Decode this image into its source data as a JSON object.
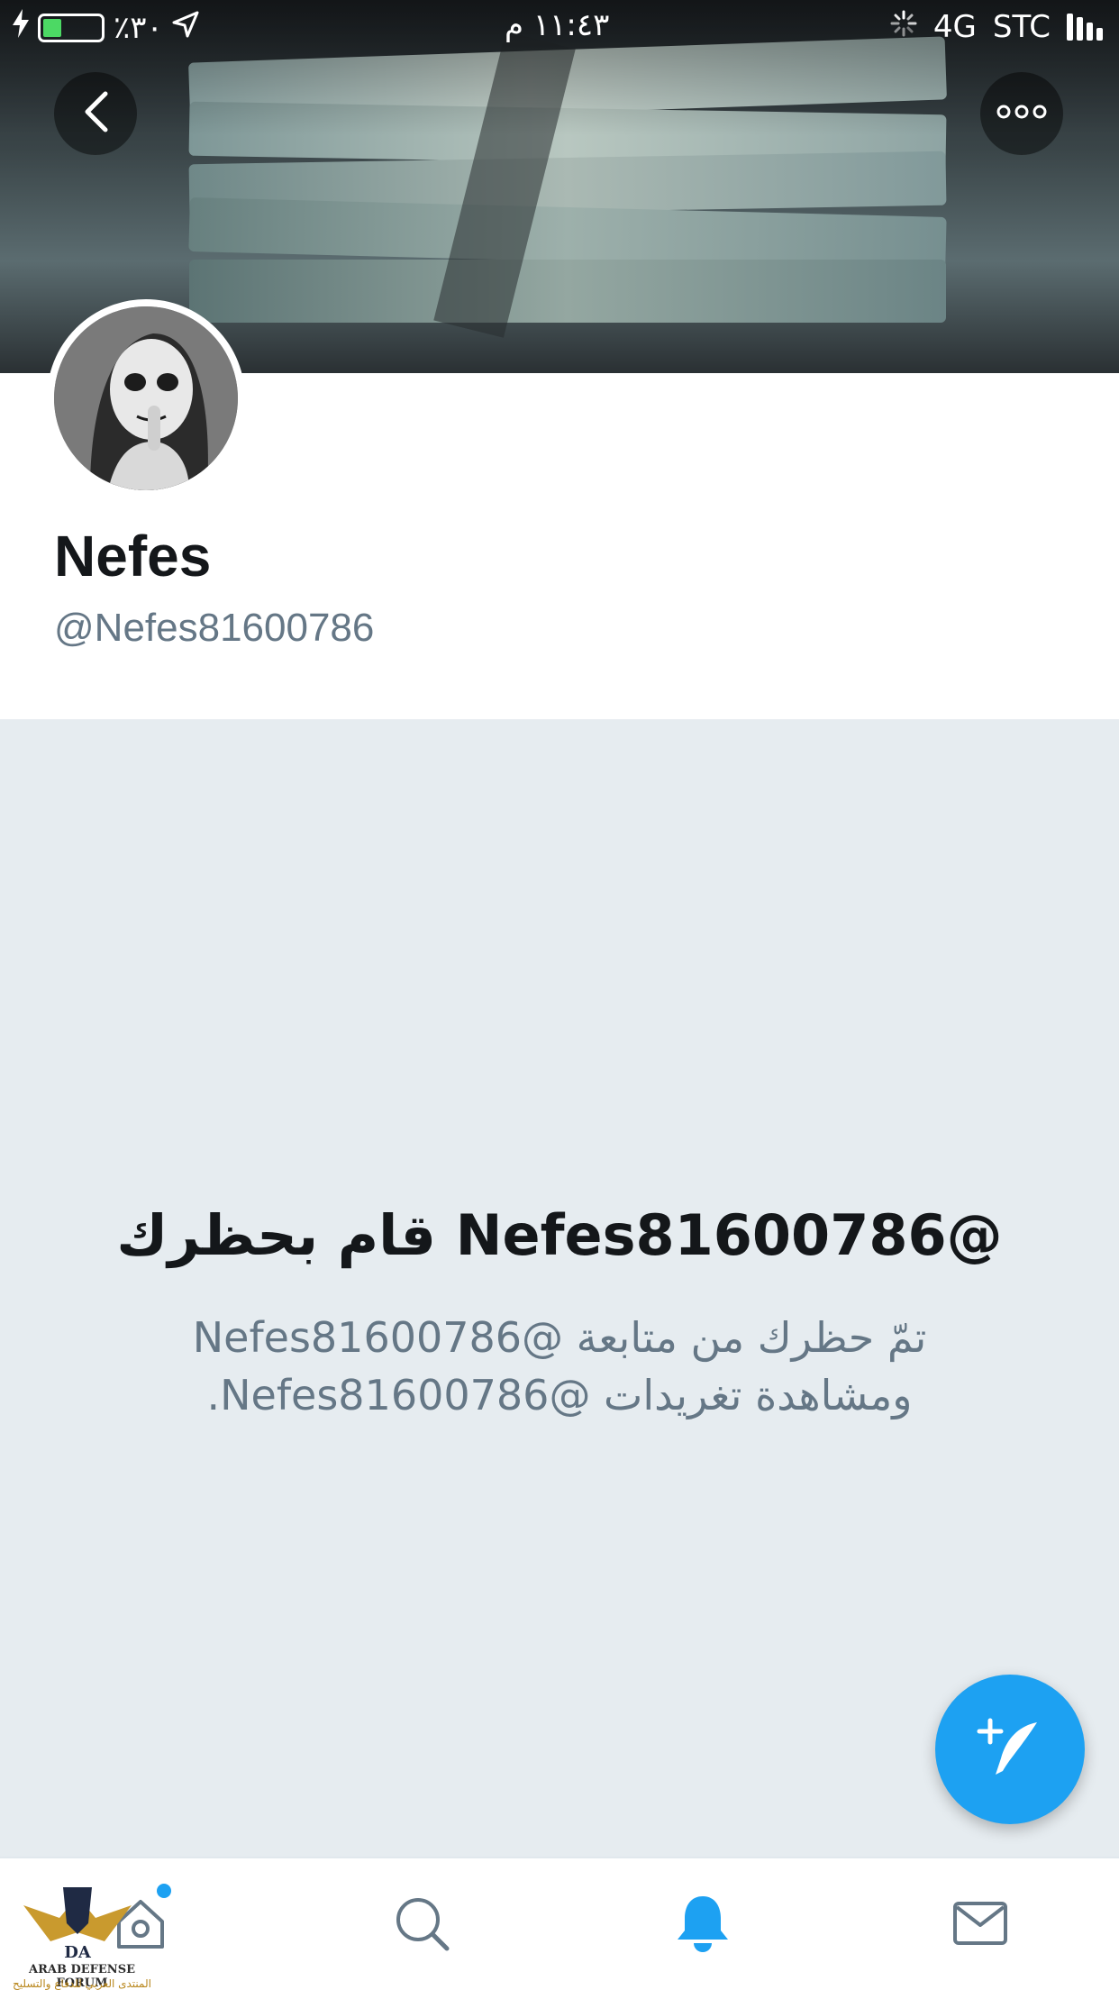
{
  "status_bar": {
    "battery_text": "٪٣٠",
    "time": "١١:٤٣ م",
    "network": "4G",
    "carrier": "STC"
  },
  "profile": {
    "name": "Nefes",
    "handle": "@Nefes81600786"
  },
  "blocked_notice": {
    "title": "@Nefes81600786 قام بحظرك",
    "message": "تمّ حظرك من متابعة @Nefes81600786 ومشاهدة تغريدات @Nefes81600786."
  },
  "tab_bar": {
    "items": [
      "home-icon",
      "search-icon",
      "bell-icon",
      "mail-icon"
    ],
    "active": "bell-icon",
    "home_has_new": true
  },
  "watermark": {
    "title": "ARAB DEFENSE FORUM",
    "subtitle": "المنتدى العربي للدفاع والتسليح"
  },
  "colors": {
    "accent": "#1da1f2",
    "handle": "#657786",
    "blocked_bg": "#e6ecf0",
    "battery": "#4cd964"
  }
}
